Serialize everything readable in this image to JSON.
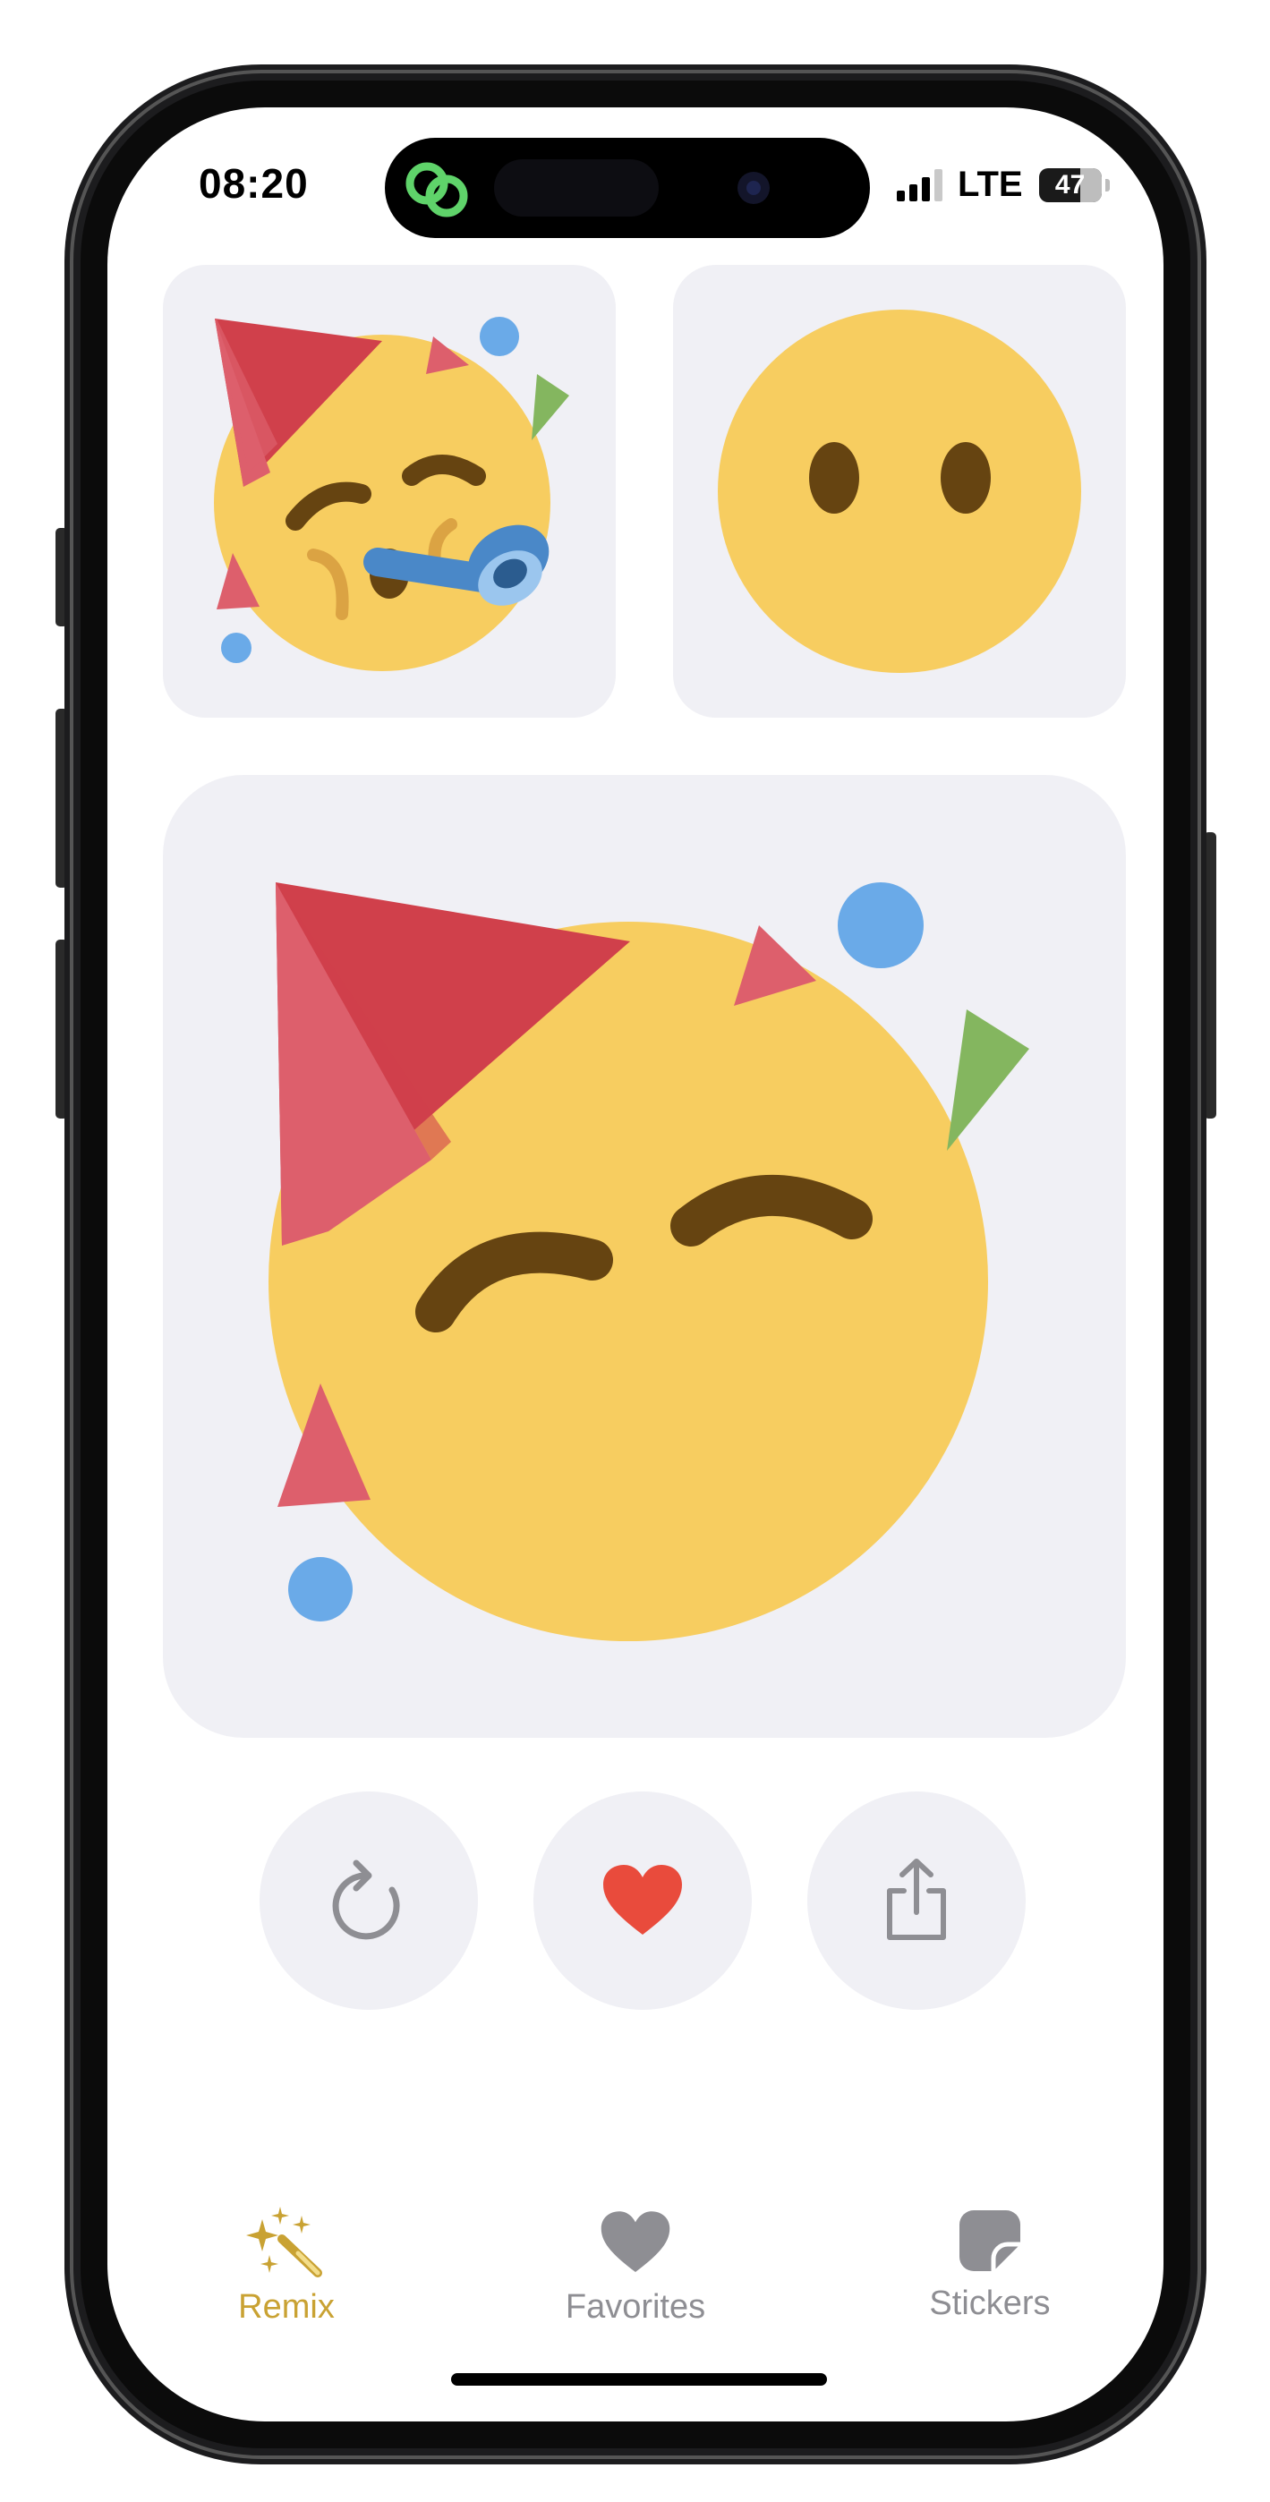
{
  "status_bar": {
    "time": "08:20",
    "network": "LTE",
    "battery": "47"
  },
  "previews": [
    {
      "name": "partying-face",
      "selected": true
    },
    {
      "name": "no-mouth-face",
      "selected": false
    }
  ],
  "main_sticker": "partying-face-remix",
  "actions": [
    {
      "name": "refresh-icon"
    },
    {
      "name": "heart-icon",
      "color": "#e94b3c"
    },
    {
      "name": "share-icon"
    }
  ],
  "tabs": [
    {
      "label": "Remix",
      "icon": "magic-wand-icon",
      "active": true,
      "color": "#c9a233"
    },
    {
      "label": "Favorites",
      "icon": "heart-icon",
      "active": false,
      "color": "#8e8e93"
    },
    {
      "label": "Stickers",
      "icon": "sticker-icon",
      "active": false,
      "color": "#8e8e93"
    }
  ],
  "colors": {
    "accent": "#c9a233",
    "face": "#f7cd60",
    "feature": "#664411",
    "hat": "#d0404b",
    "confetti_blue": "#6aaae8",
    "confetti_green": "#84b65f"
  }
}
